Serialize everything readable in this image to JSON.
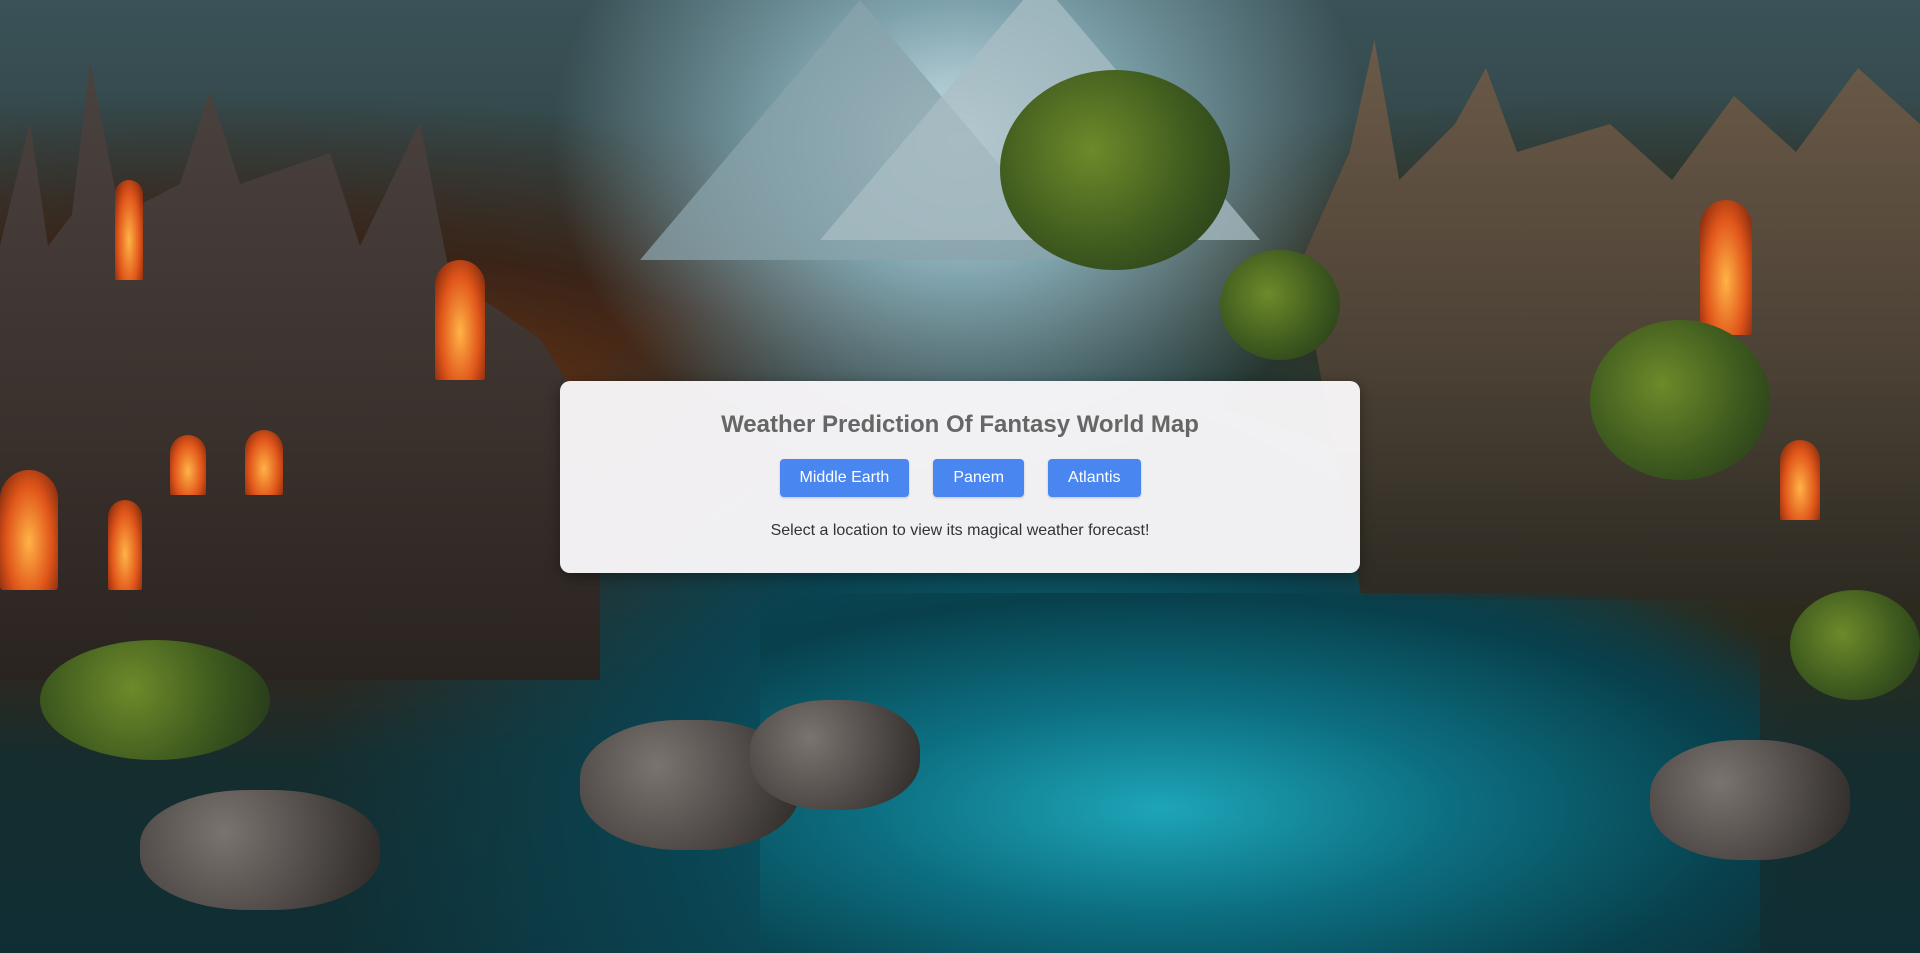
{
  "card": {
    "title": "Weather Prediction Of Fantasy World Map",
    "hint": "Select a location to view its magical weather forecast!"
  },
  "locations": [
    {
      "label": "Middle Earth"
    },
    {
      "label": "Panem"
    },
    {
      "label": "Atlantis"
    }
  ],
  "colors": {
    "button_bg": "#4a86f0",
    "button_text": "#ffffff",
    "title_text": "#666666",
    "card_bg": "#f8f6f8"
  }
}
